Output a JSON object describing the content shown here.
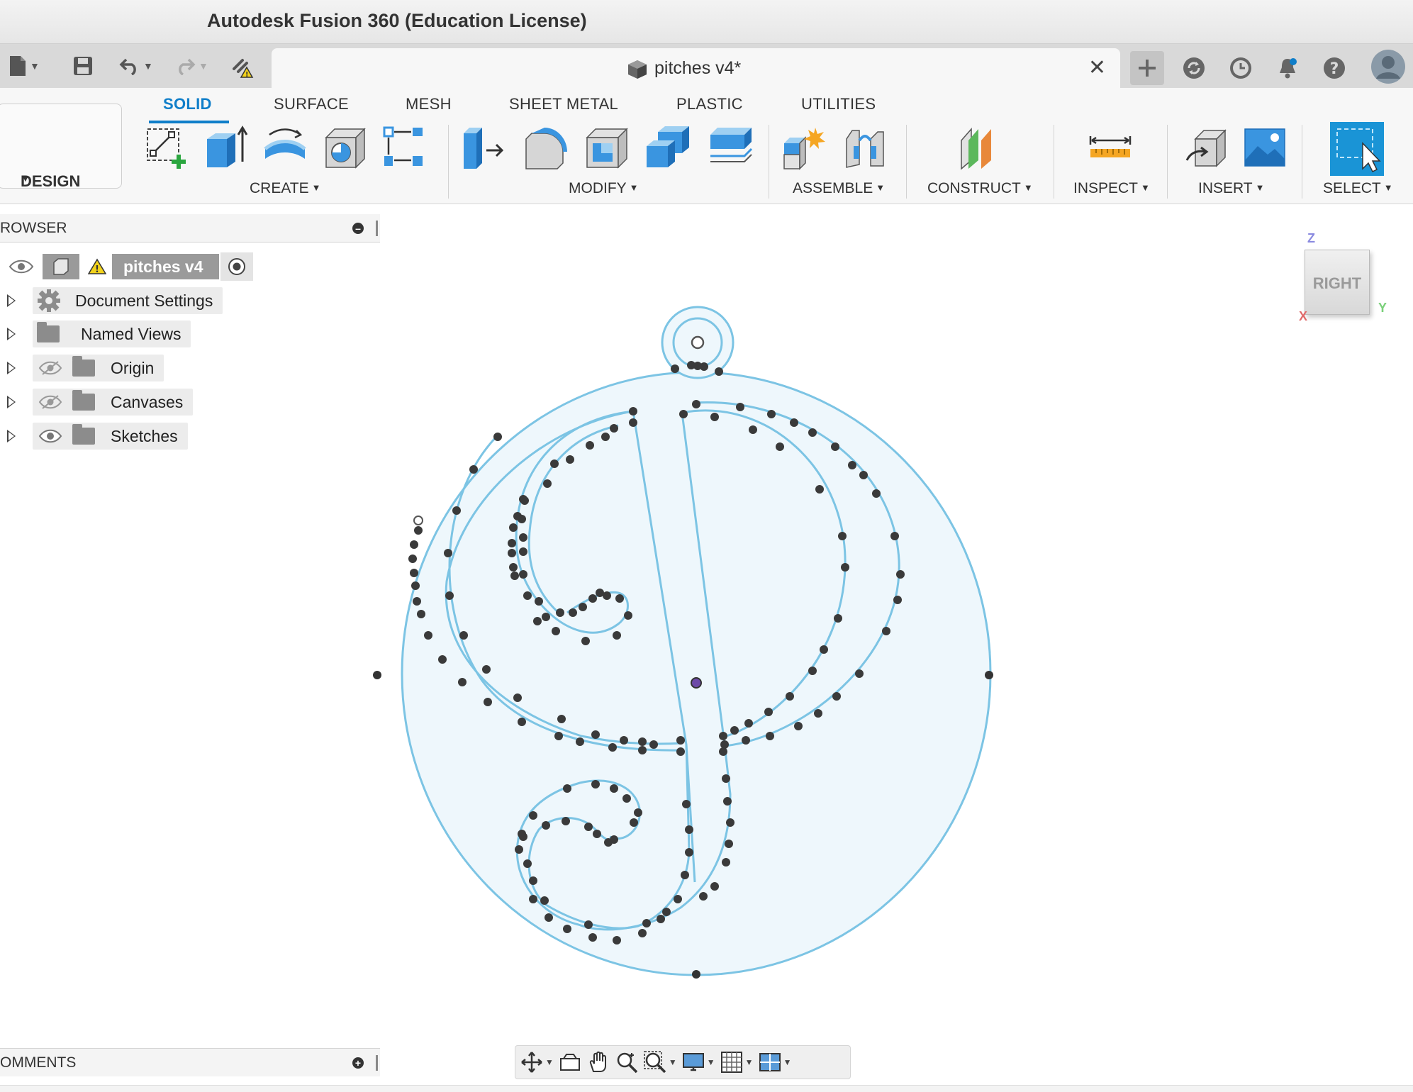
{
  "window": {
    "title": "Autodesk Fusion 360 (Education License)"
  },
  "document_tab": {
    "name": "pitches v4*",
    "close_glyph": "✕"
  },
  "workspace": {
    "label": "DESIGN"
  },
  "tabs": [
    {
      "label": "SOLID",
      "active": true
    },
    {
      "label": "SURFACE",
      "active": false
    },
    {
      "label": "MESH",
      "active": false
    },
    {
      "label": "SHEET METAL",
      "active": false
    },
    {
      "label": "PLASTIC",
      "active": false
    },
    {
      "label": "UTILITIES",
      "active": false
    }
  ],
  "groups": {
    "create": "CREATE",
    "modify": "MODIFY",
    "assemble": "ASSEMBLE",
    "construct": "CONSTRUCT",
    "inspect": "INSPECT",
    "insert": "INSERT",
    "select": "SELECT"
  },
  "browser": {
    "title": "ROWSER",
    "root": "pitches v4",
    "items": [
      {
        "label": "Document Settings",
        "icon": "gear-icon"
      },
      {
        "label": "Named Views",
        "icon": "folder-icon"
      },
      {
        "label": "Origin",
        "icon": "folder-icon",
        "visibility": "hidden"
      },
      {
        "label": "Canvases",
        "icon": "folder-icon",
        "visibility": "hidden"
      },
      {
        "label": "Sketches",
        "icon": "folder-icon",
        "visibility": "visible"
      }
    ]
  },
  "comments": {
    "title": "OMMENTS"
  },
  "viewcube": {
    "face": "RIGHT",
    "z": "Z",
    "x": "X",
    "y": "Y"
  },
  "colors": {
    "accent": "#0f7ec9",
    "sketch_line": "#7cc4e4",
    "sketch_fill": "#eef7fc",
    "point": "#333333"
  }
}
